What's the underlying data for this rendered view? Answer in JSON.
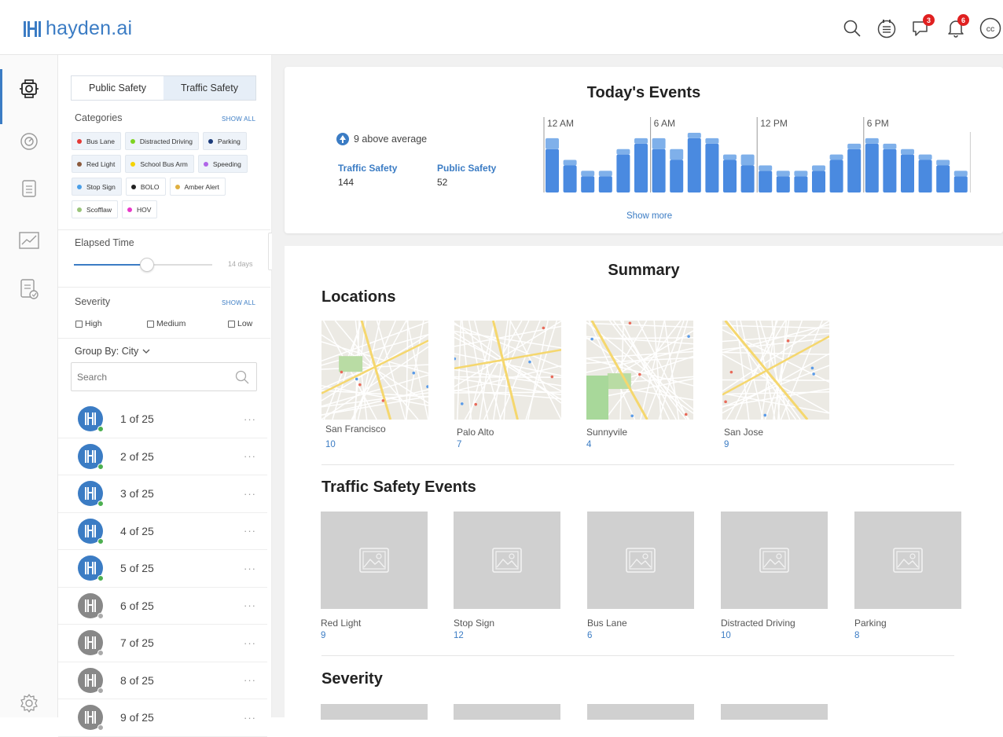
{
  "app": {
    "logo_text": "hayden.ai",
    "brand_color": "#3b7cc4"
  },
  "topbar": {
    "icons": [
      "search-icon",
      "calendar-list-icon",
      "chat-icon",
      "bell-icon",
      "cc-icon"
    ],
    "chat_badge": "3",
    "bell_badge": "6",
    "cc_label": "cc"
  },
  "nav": {
    "items": [
      "map-pin-icon",
      "speedometer-icon",
      "document-icon",
      "chart-icon",
      "report-icon",
      "settings-icon"
    ],
    "active": 0
  },
  "filters": {
    "tabs": [
      "Public Safety",
      "Traffic Safety"
    ],
    "active_tab": 1,
    "categories_label": "Categories",
    "show_all": "SHOW ALL",
    "categories": [
      {
        "label": "Bus Lane",
        "color": "#e53935",
        "selected": true
      },
      {
        "label": "Distracted Driving",
        "color": "#7ed321",
        "selected": true
      },
      {
        "label": "Parking",
        "color": "#1a3a7a",
        "selected": true
      },
      {
        "label": "Red Light",
        "color": "#8b5a3c",
        "selected": true
      },
      {
        "label": "School Bus Arm",
        "color": "#f5d300",
        "selected": true
      },
      {
        "label": "Speeding",
        "color": "#b065e8",
        "selected": true
      },
      {
        "label": "Stop Sign",
        "color": "#4a9fe8",
        "selected": true
      },
      {
        "label": "BOLO",
        "color": "#222222",
        "selected": false
      },
      {
        "label": "Amber Alert",
        "color": "#e0b040",
        "selected": false
      },
      {
        "label": "Scofflaw",
        "color": "#9ac47a",
        "selected": false
      },
      {
        "label": "HOV",
        "color": "#e838c8",
        "selected": false
      }
    ],
    "elapsed_label": "Elapsed Time",
    "elapsed_value": "14 days",
    "elapsed_fraction": 0.54,
    "severity_label": "Severity",
    "severity_show_all": "SHOW ALL",
    "severity_options": [
      "High",
      "Medium",
      "Low"
    ],
    "group_by_label": "Group By: City",
    "search_placeholder": "Search",
    "list": [
      {
        "label": "1 of 25",
        "active": true
      },
      {
        "label": "2 of 25",
        "active": true
      },
      {
        "label": "3 of 25",
        "active": true
      },
      {
        "label": "4 of 25",
        "active": true
      },
      {
        "label": "5 of 25",
        "active": true
      },
      {
        "label": "6 of 25",
        "active": false
      },
      {
        "label": "7 of 25",
        "active": false
      },
      {
        "label": "8 of 25",
        "active": false
      },
      {
        "label": "9 of 25",
        "active": false
      }
    ],
    "more_label": "···"
  },
  "events": {
    "title": "Today's Events",
    "above_average": "9 above average",
    "stats": [
      {
        "label": "Traffic Safety",
        "value": "144"
      },
      {
        "label": "Public Safety",
        "value": "52"
      }
    ],
    "show_more": "Show more"
  },
  "chart_data": {
    "type": "bar",
    "stacked": true,
    "time_labels": [
      "12 AM",
      "6 AM",
      "12 PM",
      "6 PM"
    ],
    "series": [
      {
        "values": [
          8,
          5,
          3,
          3,
          7,
          9,
          8,
          6,
          10,
          9,
          6,
          5,
          4,
          3,
          3,
          4,
          6,
          8,
          9,
          8,
          7,
          6,
          5,
          3
        ],
        "color": "#4a8ae0"
      },
      {
        "values": [
          2,
          1,
          1,
          1,
          1,
          1,
          2,
          2,
          1,
          1,
          1,
          2,
          1,
          1,
          1,
          1,
          1,
          1,
          1,
          1,
          1,
          1,
          1,
          1
        ],
        "color": "#7fb0ea"
      }
    ],
    "grid": false
  },
  "summary": {
    "title": "Summary",
    "locations_title": "Locations",
    "locations": [
      {
        "name": "San Francisco",
        "count": "10"
      },
      {
        "name": "Palo Alto",
        "count": "7"
      },
      {
        "name": "Sunnyvile",
        "count": "4"
      },
      {
        "name": "San Jose",
        "count": "9"
      }
    ],
    "traffic_title": "Traffic Safety Events",
    "traffic_events": [
      {
        "name": "Red Light",
        "count": "9"
      },
      {
        "name": "Stop Sign",
        "count": "12"
      },
      {
        "name": "Bus Lane",
        "count": "6"
      },
      {
        "name": "Distracted Driving",
        "count": "10"
      },
      {
        "name": "Parking",
        "count": "8"
      }
    ],
    "severity_title": "Severity"
  }
}
